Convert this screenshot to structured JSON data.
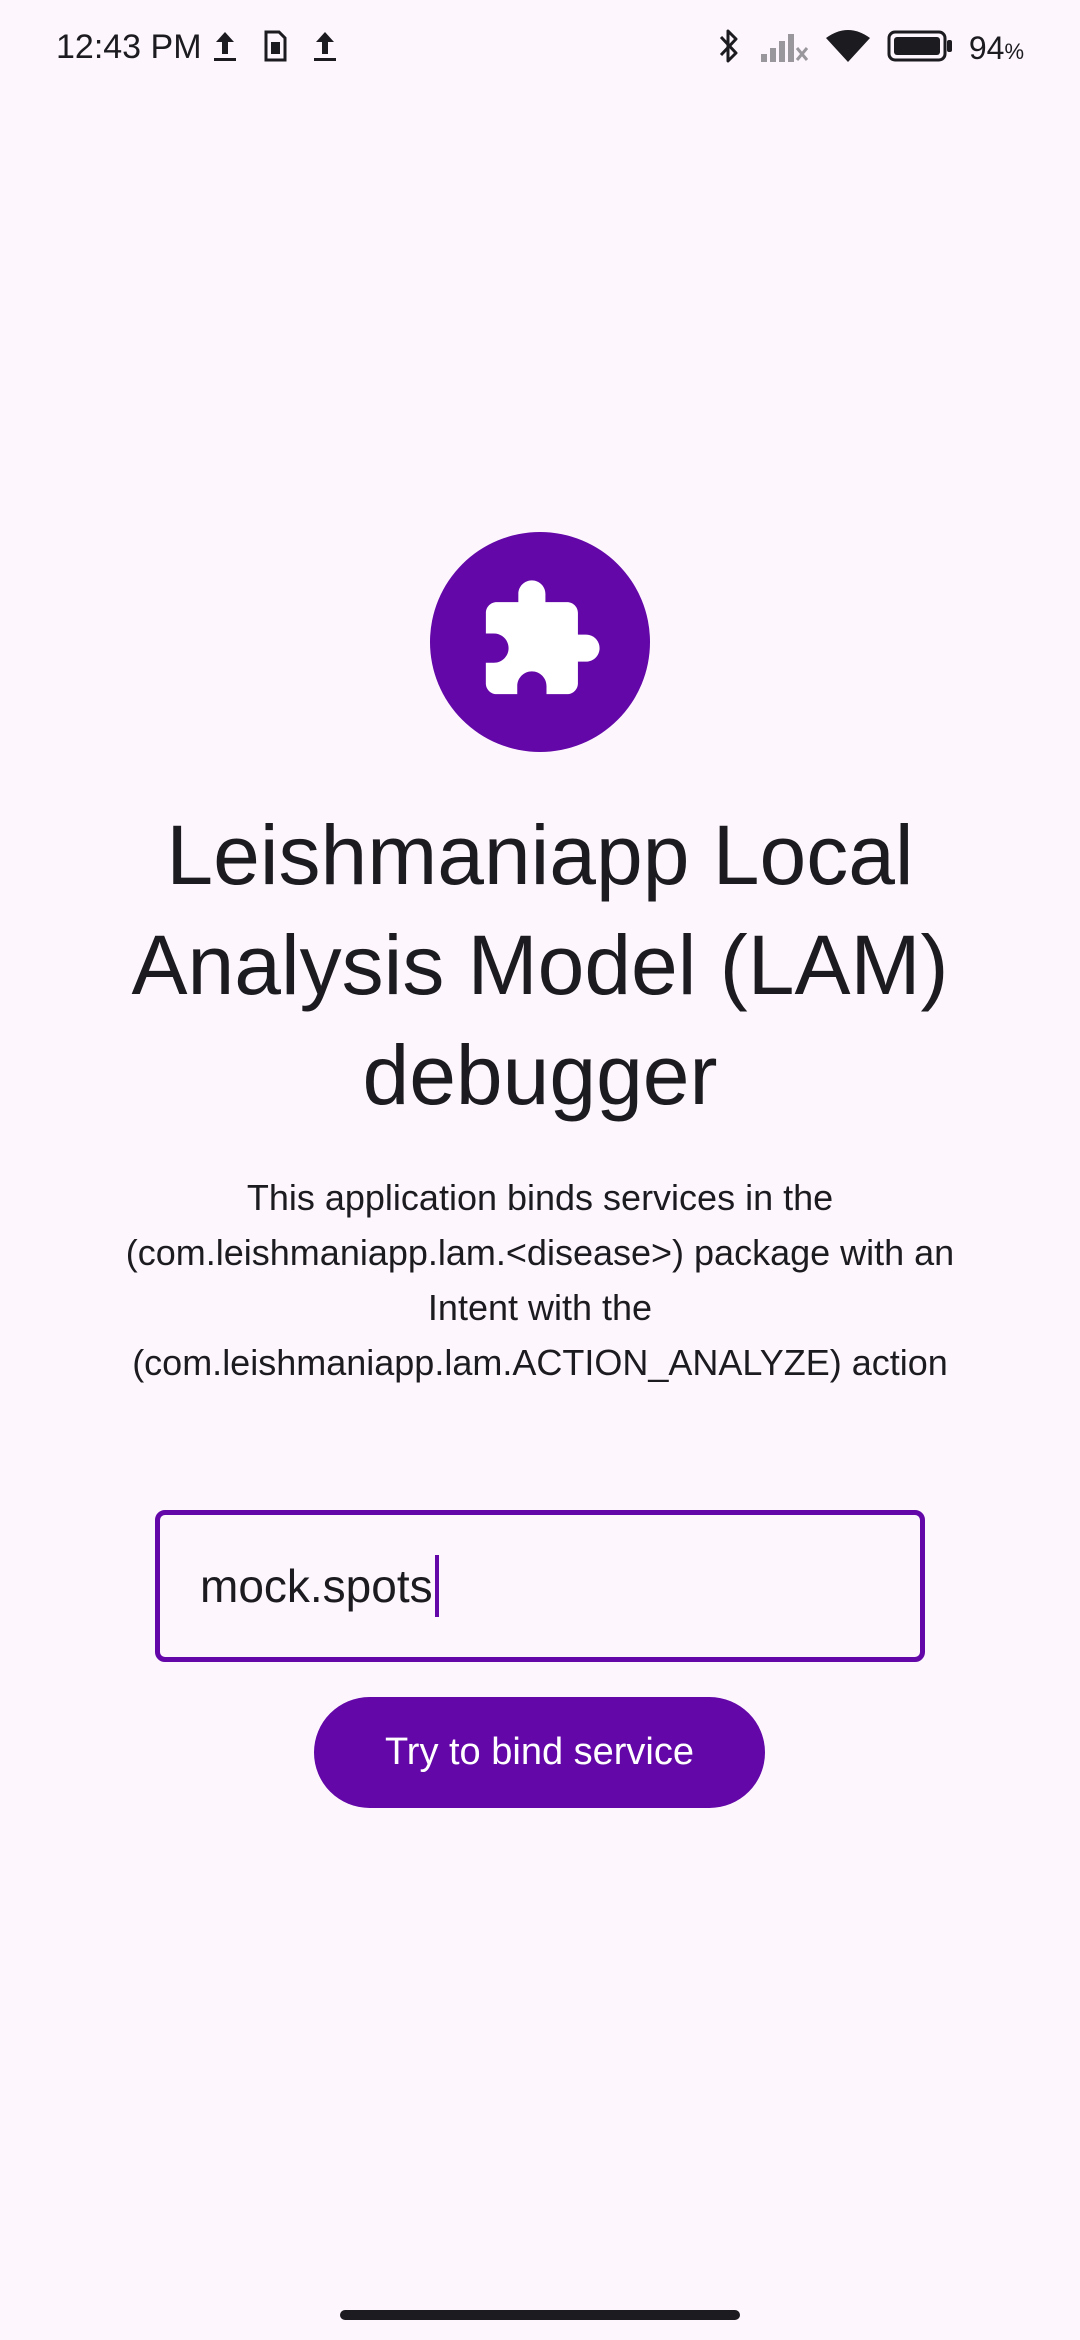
{
  "status_bar": {
    "time": "12:43 PM",
    "battery_percent": "94",
    "battery_suffix": "%",
    "left_icons": [
      "upload-icon",
      "sim-card-icon",
      "upload-icon"
    ],
    "right_icons": [
      "bluetooth-icon",
      "signal-off-icon",
      "wifi-icon",
      "battery-icon"
    ]
  },
  "app": {
    "icon": "puzzle-icon",
    "title": "Leishmaniapp Local Analysis Model (LAM) debugger",
    "description": "This application binds services in the (com.leishmaniapp.lam.<disease>) package with an Intent with the (com.leishmaniapp.lam.ACTION_ANALYZE) action"
  },
  "input": {
    "value": "mock.spots"
  },
  "button": {
    "label": "Try to bind service"
  },
  "colors": {
    "accent": "#6307a8",
    "background": "#fdf7fd",
    "text": "#1c1b1f"
  }
}
